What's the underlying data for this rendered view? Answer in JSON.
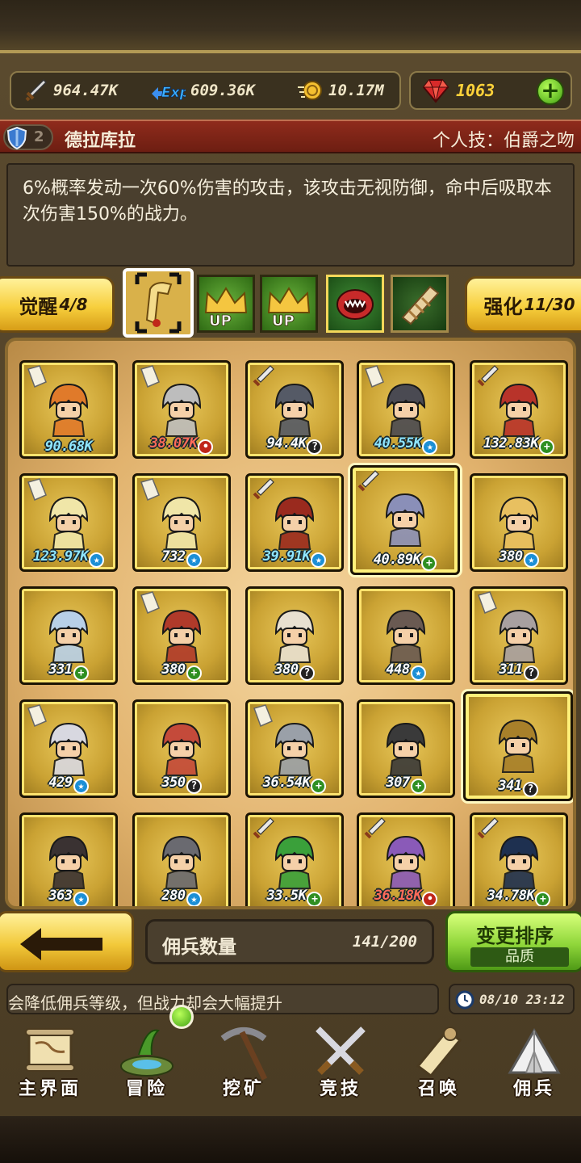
{
  "currencies": {
    "attack": {
      "icon": "sword-icon",
      "value": "964.47K"
    },
    "exp": {
      "icon": "exp-icon",
      "value": "609.36K"
    },
    "gold": {
      "icon": "gold-coin-icon",
      "value": "10.17M"
    },
    "gem": {
      "icon": "ruby-gem-icon",
      "value": "1063"
    }
  },
  "hero": {
    "rank": "2",
    "name": "德拉库拉",
    "skill_label": "个人技：伯爵之吻",
    "description": "6%概率发动一次60%伤害的攻击，该攻击无视防御，命中后吸取本次伤害150%的战力。"
  },
  "awaken": {
    "label": "觉醒",
    "value": "4/8"
  },
  "strengthen": {
    "label": "强化",
    "value": "11/30"
  },
  "tabs": [
    {
      "name": "scroll-tab",
      "selected": true
    },
    {
      "name": "crown-up-tab",
      "text": "UP"
    },
    {
      "name": "crown-up-tab-2",
      "text": "UP"
    },
    {
      "name": "monster-mouth-tab"
    },
    {
      "name": "bandage-scroll-tab"
    }
  ],
  "mercenaries": [
    {
      "power": "90.68K",
      "badge": "",
      "tag": "paper",
      "color": "#e07a2a",
      "style": "blue"
    },
    {
      "power": "38.07K",
      "badge": "red",
      "tag": "paper",
      "color": "#bdbdbd",
      "style": "red"
    },
    {
      "power": "94.4K",
      "badge": "q",
      "tag": "sword",
      "color": "#555a66",
      "style": "plain"
    },
    {
      "power": "40.55K",
      "badge": "star",
      "tag": "paper",
      "color": "#4a4a52",
      "style": "blue"
    },
    {
      "power": "132.83K",
      "badge": "plus",
      "tag": "sword",
      "color": "#b8332a",
      "style": "plain"
    },
    {
      "power": "123.97K",
      "badge": "star",
      "tag": "paper",
      "color": "#f0e6a8",
      "style": "blue"
    },
    {
      "power": "732",
      "badge": "star",
      "tag": "paper",
      "color": "#f0e6a8",
      "style": "plain"
    },
    {
      "power": "39.91K",
      "badge": "star",
      "tag": "sword",
      "color": "#9a2a1e",
      "style": "blue"
    },
    {
      "power": "40.89K",
      "badge": "plus",
      "tag": "sword",
      "color": "#8a8fb8",
      "style": "plain",
      "featured": true
    },
    {
      "power": "380",
      "badge": "star",
      "tag": "",
      "color": "#e8c060",
      "style": "plain"
    },
    {
      "power": "331",
      "badge": "plus",
      "tag": "",
      "color": "#b8d0e8",
      "style": "plain"
    },
    {
      "power": "380",
      "badge": "plus",
      "tag": "paper",
      "color": "#b03a2a",
      "style": "plain"
    },
    {
      "power": "380",
      "badge": "q",
      "tag": "",
      "color": "#e8e0d0",
      "style": "plain"
    },
    {
      "power": "448",
      "badge": "star",
      "tag": "",
      "color": "#6a5a52",
      "style": "plain"
    },
    {
      "power": "311",
      "badge": "q",
      "tag": "paper",
      "color": "#a8a0a0",
      "style": "plain"
    },
    {
      "power": "429",
      "badge": "star",
      "tag": "paper",
      "color": "#d8d8e0",
      "style": "plain"
    },
    {
      "power": "350",
      "badge": "q",
      "tag": "",
      "color": "#c44a3a",
      "style": "plain"
    },
    {
      "power": "36.54K",
      "badge": "plus",
      "tag": "paper",
      "color": "#9aa0a8",
      "style": "plain"
    },
    {
      "power": "307",
      "badge": "plus",
      "tag": "",
      "color": "#3a3a3a",
      "style": "plain"
    },
    {
      "power": "341",
      "badge": "q",
      "tag": "",
      "color": "#a8802a",
      "style": "plain",
      "featured": true
    },
    {
      "power": "363",
      "badge": "star",
      "tag": "",
      "color": "#3a3232",
      "style": "plain"
    },
    {
      "power": "280",
      "badge": "star",
      "tag": "",
      "color": "#6a6a70",
      "style": "plain"
    },
    {
      "power": "33.5K",
      "badge": "plus",
      "tag": "sword",
      "color": "#3aa03a",
      "style": "plain"
    },
    {
      "power": "36.18K",
      "badge": "red",
      "tag": "sword",
      "color": "#8a5ab8",
      "style": "red"
    },
    {
      "power": "34.78K",
      "badge": "plus",
      "tag": "sword",
      "color": "#1e3050",
      "style": "plain"
    }
  ],
  "mercenary_count": {
    "label": "佣兵数量",
    "value": "141/200"
  },
  "sort": {
    "label": "变更排序",
    "current": "品质"
  },
  "tip": "会降低佣兵等级，但战力却会大幅提升",
  "clock": "08/10 23:12",
  "nav": [
    {
      "label": "主界面",
      "icon": "map-scroll-icon"
    },
    {
      "label": "冒险",
      "icon": "island-icon"
    },
    {
      "label": "挖矿",
      "icon": "pickaxe-icon"
    },
    {
      "label": "竞技",
      "icon": "crossed-swords-icon"
    },
    {
      "label": "召唤",
      "icon": "summon-scroll-icon"
    },
    {
      "label": "佣兵",
      "icon": "tent-icon"
    }
  ]
}
